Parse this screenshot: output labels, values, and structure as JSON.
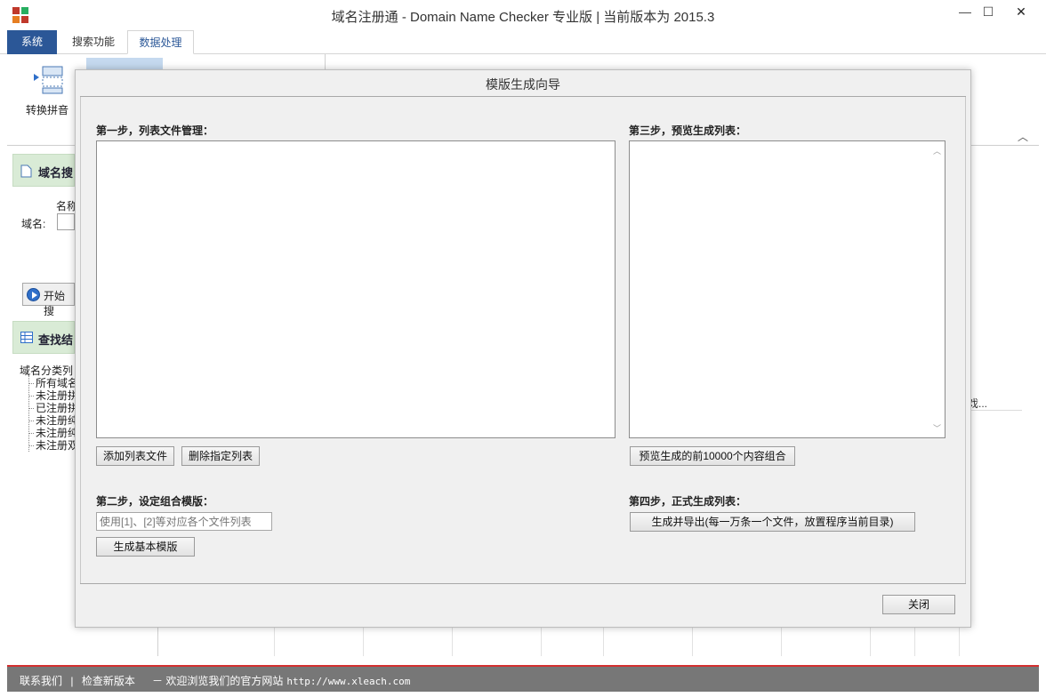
{
  "window": {
    "title": "域名注册通 - Domain Name Checker 专业版 | 当前版本为 2015.3",
    "minimize": "—",
    "maximize": "☐",
    "close": "✕"
  },
  "ribbon": {
    "tabs": [
      {
        "label": "系统"
      },
      {
        "label": "搜索功能"
      },
      {
        "label": "数据处理"
      }
    ],
    "buttons": [
      {
        "label": "转换拼音",
        "icon": "convert-pinyin-icon"
      }
    ],
    "collapse_glyph": "︿"
  },
  "left_panel": {
    "search_header": "域名搜",
    "name_label": "名称",
    "domain_label": "域名:",
    "start_button": "开始搜",
    "results_header": "查找结",
    "tree": {
      "root": "域名分类列",
      "items": [
        "所有域名",
        "未注册拼",
        "已注册拼",
        "未注册纯",
        "未注册纯",
        "未注册双"
      ]
    }
  },
  "background_grid": {
    "truncated_header": "戏..."
  },
  "statusbar": {
    "contact": "联系我们",
    "check_update": "检查新版本",
    "separator": "|",
    "welcome": "－ 欢迎浏览我们的官方网站",
    "url": "http://www.xleach.com"
  },
  "dialog": {
    "title": "模版生成向导",
    "step1": {
      "label": "第一步，列表文件管理：",
      "add_button": "添加列表文件",
      "delete_button": "删除指定列表"
    },
    "step2": {
      "label": "第二步，设定组合模版：",
      "template_placeholder": "使用[1]、[2]等对应各个文件列表",
      "generate_button": "生成基本模版"
    },
    "step3": {
      "label": "第三步，预览生成列表：",
      "preview_button": "预览生成的前10000个内容组合"
    },
    "step4": {
      "label": "第四步，正式生成列表：",
      "export_button": "生成并导出(每一万条一个文件，放置程序当前目录)"
    },
    "close_button": "关闭"
  }
}
